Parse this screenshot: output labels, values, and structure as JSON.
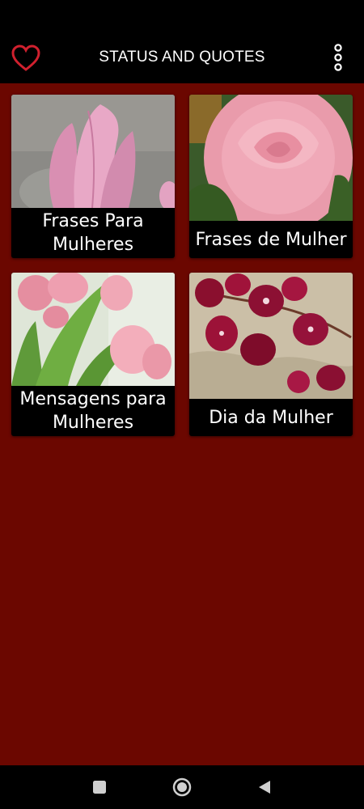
{
  "app": {
    "title": "STATUS AND QUOTES",
    "accent_color": "#c8102e",
    "background_color": "#6b0700"
  },
  "toolbar": {
    "favorite_icon": "heart-outline-icon",
    "menu_icon": "more-vert-icon"
  },
  "categories": [
    {
      "label": "Frases Para Mulheres",
      "image": "pink-tulip-photo"
    },
    {
      "label": "Frases de Mulher",
      "image": "pink-rose-photo"
    },
    {
      "label": "Mensagens para Mulheres",
      "image": "pink-tulips-bouquet-photo"
    },
    {
      "label": "Dia da Mulher",
      "image": "red-orchids-photo"
    }
  ],
  "navigation": {
    "recents_icon": "square-icon",
    "home_icon": "home-circle-icon",
    "back_icon": "back-triangle-icon"
  }
}
